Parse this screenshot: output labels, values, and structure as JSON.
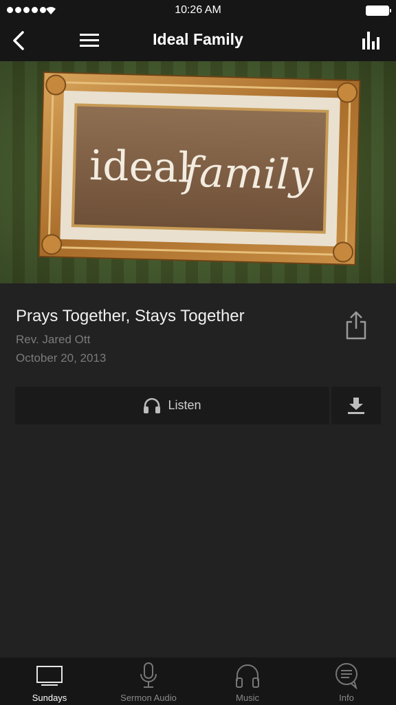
{
  "status": {
    "time": "10:26 AM"
  },
  "nav": {
    "title": "Ideal Family"
  },
  "banner": {
    "text_left": "ideal",
    "text_right": "family"
  },
  "sermon": {
    "title": "Prays Together, Stays Together",
    "speaker": "Rev. Jared Ott",
    "date": "October 20, 2013"
  },
  "actions": {
    "listen_label": "Listen"
  },
  "tabs": [
    {
      "label": "Sundays",
      "icon": "tv-icon",
      "active": true
    },
    {
      "label": "Sermon Audio",
      "icon": "microphone-icon",
      "active": false
    },
    {
      "label": "Music",
      "icon": "headphones-icon",
      "active": false
    },
    {
      "label": "Info",
      "icon": "chat-bubble-icon",
      "active": false
    }
  ],
  "colors": {
    "background": "#222222",
    "bar": "#161616",
    "banner_green": "#4f6530",
    "frame_gold": "#b8803a",
    "muted_text": "#7b7b7b"
  }
}
